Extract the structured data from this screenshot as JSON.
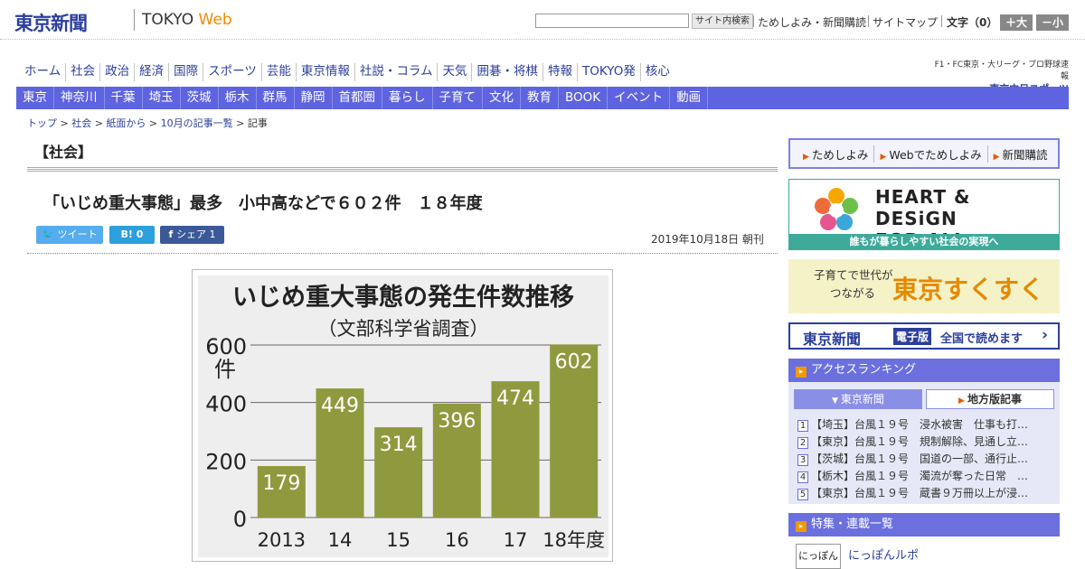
{
  "header": {
    "logo": "東京新聞",
    "logo_web_prefix": "TOKYO ",
    "logo_web_suffix": "Web",
    "search_button": "サイト内検索",
    "links": [
      "ためしよみ・新聞購読",
      "サイトマップ"
    ],
    "font_size_label": "文字（0）",
    "font_bigger": "＋大",
    "font_smaller": "－小"
  },
  "nav_primary": [
    "ホーム",
    "社会",
    "政治",
    "経済",
    "国際",
    "スポーツ",
    "芸能",
    "東京情報",
    "社説・コラム",
    "天気",
    "囲碁・将棋",
    "特報",
    "TOKYO発",
    "核心"
  ],
  "chunichi_banner": {
    "top": "F1・FC東京・大リーグ・プロ野球速報",
    "main": "東京中日スポーツ"
  },
  "nav_secondary": [
    "東京",
    "神奈川",
    "千葉",
    "埼玉",
    "茨城",
    "栃木",
    "群馬",
    "静岡",
    "首都圏",
    "暮らし",
    "子育て",
    "文化",
    "教育",
    "BOOK",
    "イベント",
    "動画"
  ],
  "breadcrumb": [
    "トップ",
    "社会",
    "紙面から",
    "10月の記事一覧",
    "記事"
  ],
  "article": {
    "section": "【社会】",
    "headline": "「いじめ重大事態」最多　小中高などで６０２件　１８年度",
    "date": "2019年10月18日 朝刊",
    "share": {
      "tweet": "ツイート",
      "hatena": "B! 0",
      "facebook": "シェア 1"
    }
  },
  "chart_data": {
    "type": "bar",
    "title": "いじめ重大事態の発生件数推移",
    "subtitle": "（文部科学省調査）",
    "ylabel": "件",
    "categories": [
      "2013",
      "14",
      "15",
      "16",
      "17",
      "18年度"
    ],
    "values": [
      179,
      449,
      314,
      396,
      474,
      602
    ],
    "ylim": [
      0,
      600
    ],
    "yticks": [
      0,
      200,
      400,
      600
    ],
    "grid": true,
    "bar_color": "#8f9a3e"
  },
  "sidebar": {
    "trial_links": [
      "ためしよみ",
      "Webでためしよみ",
      "新聞購読"
    ],
    "hd_banner": {
      "title_line1": "HEART & DESiGN",
      "title_line2": "FOR ALL",
      "footer": "誰もが暮らしやすい社会の実現へ"
    },
    "suku_banner": {
      "line1": "子育てで世代が",
      "line2": "つながる",
      "brand": "東京すくすく"
    },
    "digital_banner": {
      "logo": "東京新聞",
      "badge": "電子版",
      "text": "全国で読めます"
    },
    "ranking": {
      "heading": "アクセスランキング",
      "tabs": [
        "東京新聞",
        "地方版記事"
      ],
      "items": [
        {
          "num": "1",
          "text": "【埼玉】台風１９号　浸水被害　仕事も打…"
        },
        {
          "num": "2",
          "text": "【東京】台風１９号　規制解除、見通し立…"
        },
        {
          "num": "3",
          "text": "【茨城】台風１９号　国道の一部、通行止…"
        },
        {
          "num": "4",
          "text": "【栃木】台風１９号　濁流が奪った日常　…"
        },
        {
          "num": "5",
          "text": "【東京】台風１９号　蔵書９万冊以上が浸…"
        }
      ]
    },
    "features": {
      "heading": "特集・連載一覧",
      "thumb": "にっぽん",
      "title": "にっぽんルポ"
    }
  }
}
